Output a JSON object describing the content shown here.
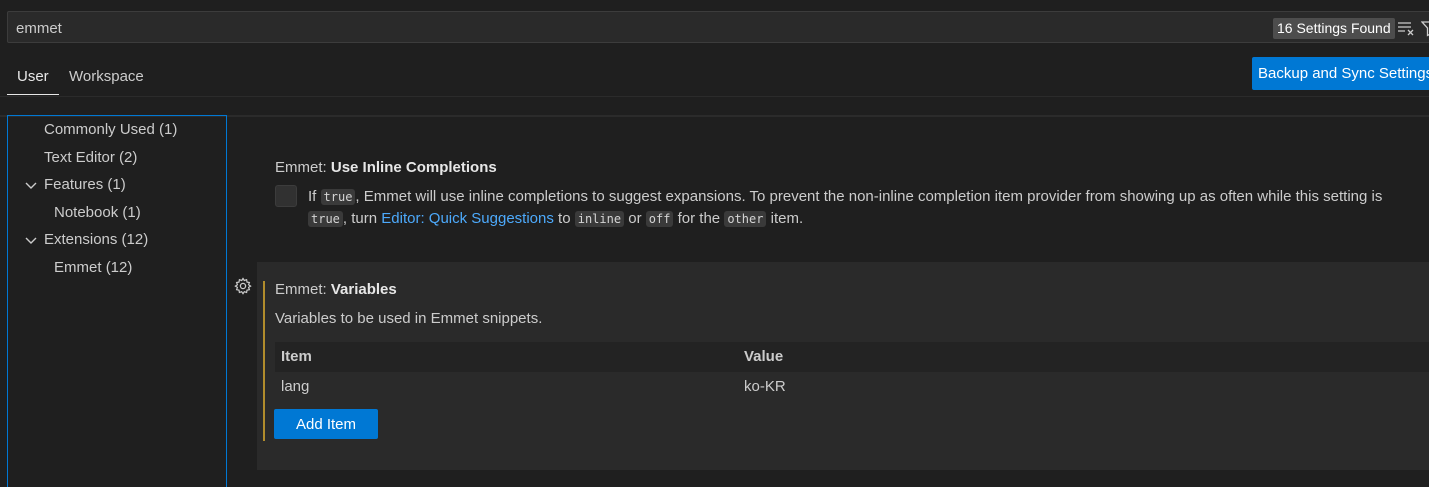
{
  "search": {
    "value": "emmet",
    "results_count": "16 Settings Found"
  },
  "tabs": [
    {
      "label": "User"
    },
    {
      "label": "Workspace"
    }
  ],
  "sync_button_label": "Backup and Sync Settings",
  "toc": {
    "items": [
      {
        "label": "Commonly Used",
        "count": "(1)"
      },
      {
        "label": "Text Editor",
        "count": "(2)"
      },
      {
        "label": "Features",
        "count": "(1)"
      },
      {
        "label": "Notebook",
        "count": "(1)"
      },
      {
        "label": "Extensions",
        "count": "(12)"
      },
      {
        "label": "Emmet",
        "count": "(12)"
      }
    ]
  },
  "settings": {
    "inline": {
      "category": "Emmet:",
      "name": "Use Inline Completions",
      "desc_if": "If",
      "desc_code_true": "true",
      "desc_mid1": ", Emmet will use inline completions to suggest expansions. To prevent the non-inline completion item provider from showing up as often while this",
      "desc_setting_is": "setting is",
      "desc_turn": ", turn",
      "desc_link": "Editor: Quick Suggestions",
      "desc_to": "to",
      "desc_code_inline": "inline",
      "desc_or": "or",
      "desc_code_off": "off",
      "desc_for_the": "for the",
      "desc_code_other": "other",
      "desc_item": "item."
    },
    "variables": {
      "category": "Emmet:",
      "name": "Variables",
      "description": "Variables to be used in Emmet snippets.",
      "columns": {
        "item": "Item",
        "value": "Value"
      },
      "rows": [
        {
          "item": "lang",
          "value": "ko-KR"
        }
      ],
      "add_label": "Add Item"
    }
  },
  "colors": {
    "accent": "#0078d4",
    "link": "#4daafc",
    "modified": "#b18c2c"
  }
}
